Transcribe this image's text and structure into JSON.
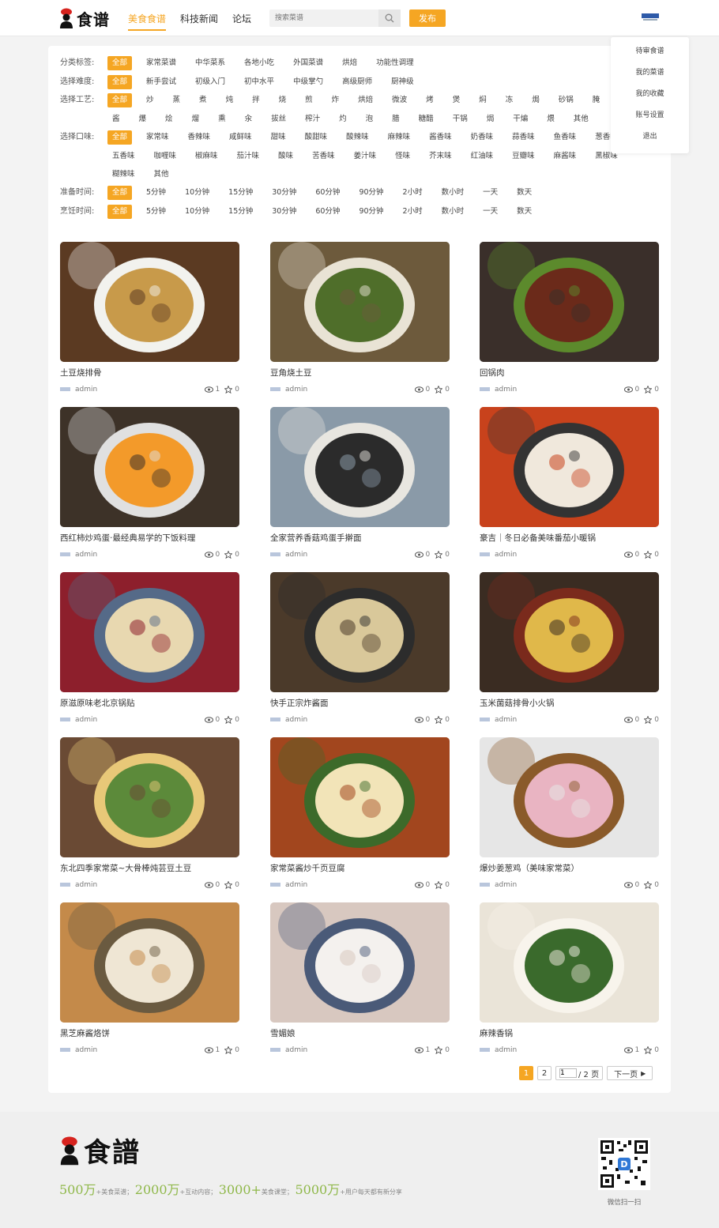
{
  "header": {
    "logo_text": "食谱",
    "nav": [
      {
        "label": "美食食谱",
        "active": true
      },
      {
        "label": "科技新闻",
        "active": false
      },
      {
        "label": "论坛",
        "active": false
      }
    ],
    "search_placeholder": "搜索菜谱",
    "publish_label": "发布"
  },
  "user_menu": [
    "待审食谱",
    "我的菜谱",
    "我的收藏",
    "账号设置",
    "退出"
  ],
  "filters": {
    "category": {
      "label": "分类标签:",
      "options": [
        "全部",
        "家常菜谱",
        "中华菜系",
        "各地小吃",
        "外国菜谱",
        "烘焙",
        "功能性调理"
      ]
    },
    "difficulty": {
      "label": "选择难度:",
      "options": [
        "全部",
        "新手尝试",
        "初级入门",
        "初中水平",
        "中级掌勺",
        "高级厨师",
        "厨神级"
      ]
    },
    "technique": {
      "label": "选择工艺:",
      "options": [
        "全部",
        "炒",
        "蒸",
        "煮",
        "炖",
        "拌",
        "烧",
        "煎",
        "炸",
        "烘焙",
        "微波",
        "烤",
        "煲",
        "焖",
        "冻",
        "焗",
        "砂锅",
        "腌",
        "卤",
        "酱",
        "爆",
        "烩",
        "熘",
        "熏",
        "汆",
        "拔丝",
        "榨汁",
        "灼",
        "泡",
        "腊",
        "糖醋",
        "干锅",
        "焗",
        "干煸",
        "煨",
        "其他"
      ]
    },
    "flavor": {
      "label": "选择口味:",
      "options": [
        "全部",
        "家常味",
        "香辣味",
        "咸鲜味",
        "甜味",
        "酸甜味",
        "酸辣味",
        "麻辣味",
        "酱香味",
        "奶香味",
        "蒜香味",
        "鱼香味",
        "葱香味",
        "五香味",
        "咖喱味",
        "椒麻味",
        "茄汁味",
        "酸味",
        "苦香味",
        "姜汁味",
        "怪味",
        "芥末味",
        "红油味",
        "豆瓣味",
        "麻酱味",
        "黑椒味",
        "糊辣味",
        "其他"
      ]
    },
    "prep_time": {
      "label": "准备时间:",
      "options": [
        "全部",
        "5分钟",
        "10分钟",
        "15分钟",
        "30分钟",
        "60分钟",
        "90分钟",
        "2小时",
        "数小时",
        "一天",
        "数天"
      ]
    },
    "cook_time": {
      "label": "烹饪时间:",
      "options": [
        "全部",
        "5分钟",
        "10分钟",
        "15分钟",
        "30分钟",
        "60分钟",
        "90分钟",
        "2小时",
        "数小时",
        "一天",
        "数天"
      ]
    }
  },
  "recipes": [
    {
      "title": "土豆烧排骨",
      "author": "admin",
      "views": "1",
      "stars": "0",
      "palette": [
        "#5b3a22",
        "#c89a4a",
        "#f2f2ee"
      ]
    },
    {
      "title": "豆角烧土豆",
      "author": "admin",
      "views": "0",
      "stars": "0",
      "palette": [
        "#6d5a3c",
        "#4f6e2a",
        "#e9e3d5"
      ]
    },
    {
      "title": "回锅肉",
      "author": "admin",
      "views": "0",
      "stars": "0",
      "palette": [
        "#3a2f2a",
        "#6b2a1a",
        "#5c8a2c"
      ]
    },
    {
      "title": "西红柿炒鸡蛋·最经典易学的下饭料理",
      "author": "admin",
      "views": "0",
      "stars": "0",
      "palette": [
        "#3d3228",
        "#f39a2a",
        "#e0e0e0"
      ]
    },
    {
      "title": "全家营养香菇鸡蛋手擀面",
      "author": "admin",
      "views": "0",
      "stars": "0",
      "palette": [
        "#8a9aa8",
        "#2b2b2b",
        "#e8e6e0"
      ]
    },
    {
      "title": "豪吉｜冬日必备美味番茄小暖锅",
      "author": "admin",
      "views": "0",
      "stars": "0",
      "palette": [
        "#c8421c",
        "#f0e8dc",
        "#333"
      ]
    },
    {
      "title": "原滋原味老北京锅贴",
      "author": "admin",
      "views": "0",
      "stars": "0",
      "palette": [
        "#8d1f2c",
        "#e8d8b0",
        "#556a88"
      ]
    },
    {
      "title": "快手正宗炸酱面",
      "author": "admin",
      "views": "0",
      "stars": "0",
      "palette": [
        "#4b3a2a",
        "#d9c89a",
        "#2c2c2c"
      ]
    },
    {
      "title": "玉米菌菇排骨小火锅",
      "author": "admin",
      "views": "0",
      "stars": "0",
      "palette": [
        "#3a2c22",
        "#e0b84a",
        "#7a2a1c"
      ]
    },
    {
      "title": "东北四季家常菜~大骨棒炖芸豆土豆",
      "author": "admin",
      "views": "0",
      "stars": "0",
      "palette": [
        "#6a4a34",
        "#5c8a3a",
        "#e8c878"
      ]
    },
    {
      "title": "家常菜酱炒千页豆腐",
      "author": "admin",
      "views": "0",
      "stars": "0",
      "palette": [
        "#a2461e",
        "#f2e4b8",
        "#3c6a2a"
      ]
    },
    {
      "title": "爆炒姜葱鸡（美味家常菜）",
      "author": "admin",
      "views": "0",
      "stars": "0",
      "palette": [
        "#e6e6e6",
        "#e9b4c2",
        "#8a5a2a"
      ]
    },
    {
      "title": "黑芝麻酱烙饼",
      "author": "admin",
      "views": "1",
      "stars": "0",
      "palette": [
        "#c48a4a",
        "#efe6d4",
        "#6a5a40"
      ]
    },
    {
      "title": "雪媚娘",
      "author": "admin",
      "views": "1",
      "stars": "0",
      "palette": [
        "#d8c8c0",
        "#f4f1ee",
        "#4a5a78"
      ]
    },
    {
      "title": "麻辣香锅",
      "author": "admin",
      "views": "1",
      "stars": "0",
      "palette": [
        "#eae4d8",
        "#3a6a2c",
        "#f8f4ec"
      ]
    }
  ],
  "pagination": {
    "current": "1",
    "page2": "2",
    "jump_value": "1",
    "total_label": "/ 2 页",
    "next_label": "下一页"
  },
  "footer": {
    "logo_text": "食譜",
    "stats": [
      {
        "num": "500万",
        "suffix": "+美食菜谱；"
      },
      {
        "num": "2000万",
        "suffix": "+互动内容；"
      },
      {
        "num": "3000+",
        "suffix": "美食课堂；"
      },
      {
        "num": "5000万",
        "suffix": "+用户每天都有新分享"
      }
    ],
    "qr_label": "微信扫一扫"
  },
  "colors": {
    "accent": "#f5a623",
    "footer_green": "#8fb84a"
  }
}
